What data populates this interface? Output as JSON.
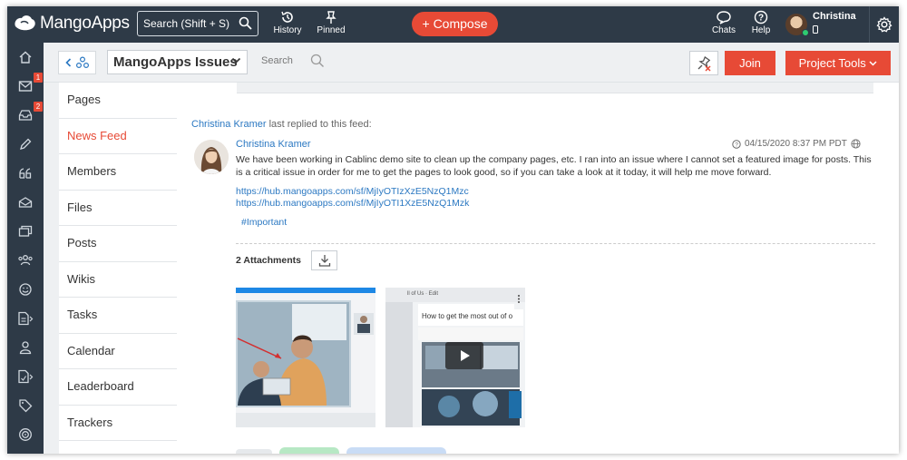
{
  "app": {
    "name": "MangoApps"
  },
  "topbar": {
    "search_label": "Search (Shift + S)",
    "history_label": "History",
    "pinned_label": "Pinned",
    "compose_label": "+ Compose",
    "chats_label": "Chats",
    "help_label": "Help",
    "user_name": "Christina"
  },
  "rail": {
    "items": [
      {
        "icon": "home-icon"
      },
      {
        "icon": "mail-icon",
        "badge": "1"
      },
      {
        "icon": "inbox-icon",
        "badge": "2"
      },
      {
        "icon": "pencil-icon"
      },
      {
        "icon": "quote-icon"
      },
      {
        "icon": "tray-icon"
      },
      {
        "icon": "folders-icon"
      },
      {
        "icon": "people-icon"
      },
      {
        "icon": "smiley-icon"
      },
      {
        "icon": "document-arrow-icon"
      },
      {
        "icon": "person-icon"
      },
      {
        "icon": "document-arrow-icon-2"
      },
      {
        "icon": "tag-icon"
      },
      {
        "icon": "target-icon"
      }
    ]
  },
  "subheader": {
    "group_name": "MangoApps Issues",
    "search_label": "Search",
    "join_label": "Join",
    "tools_label": "Project Tools"
  },
  "subnav": {
    "items": [
      {
        "label": "Pages",
        "active": false
      },
      {
        "label": "News Feed",
        "active": true
      },
      {
        "label": "Members",
        "active": false
      },
      {
        "label": "Files",
        "active": false
      },
      {
        "label": "Posts",
        "active": false
      },
      {
        "label": "Wikis",
        "active": false
      },
      {
        "label": "Tasks",
        "active": false
      },
      {
        "label": "Calendar",
        "active": false
      },
      {
        "label": "Leaderboard",
        "active": false
      },
      {
        "label": "Trackers",
        "active": false
      }
    ]
  },
  "feed": {
    "replied_name": "Christina Kramer",
    "replied_text": "last replied to this feed:",
    "post": {
      "author": "Christina Kramer",
      "date": "04/15/2020 8:37 PM PDT",
      "body": "We have been working in Cablinc demo site to clean up the company pages, etc. I ran into an issue where I cannot set a featured image for posts. This is a critical issue in order for me to get the pages to look good, so if you can take a look at it today, it will help me move forward.",
      "link1": "https://hub.mangoapps.com/sf/MjIyOTIzXzE5NzQ1Mzc",
      "link2": "https://hub.mangoapps.com/sf/MjIyOTI1XzE5NzQ1Mzk",
      "hashtag": "#Important",
      "attachments_label": "2 Attachments"
    },
    "video_thumb": {
      "header": "ll of Us · Edit",
      "title": "How to get the most out of o"
    }
  },
  "colors": {
    "nav_bg": "#2e3a47",
    "accent": "#e74a36",
    "link": "#2b78c2"
  }
}
